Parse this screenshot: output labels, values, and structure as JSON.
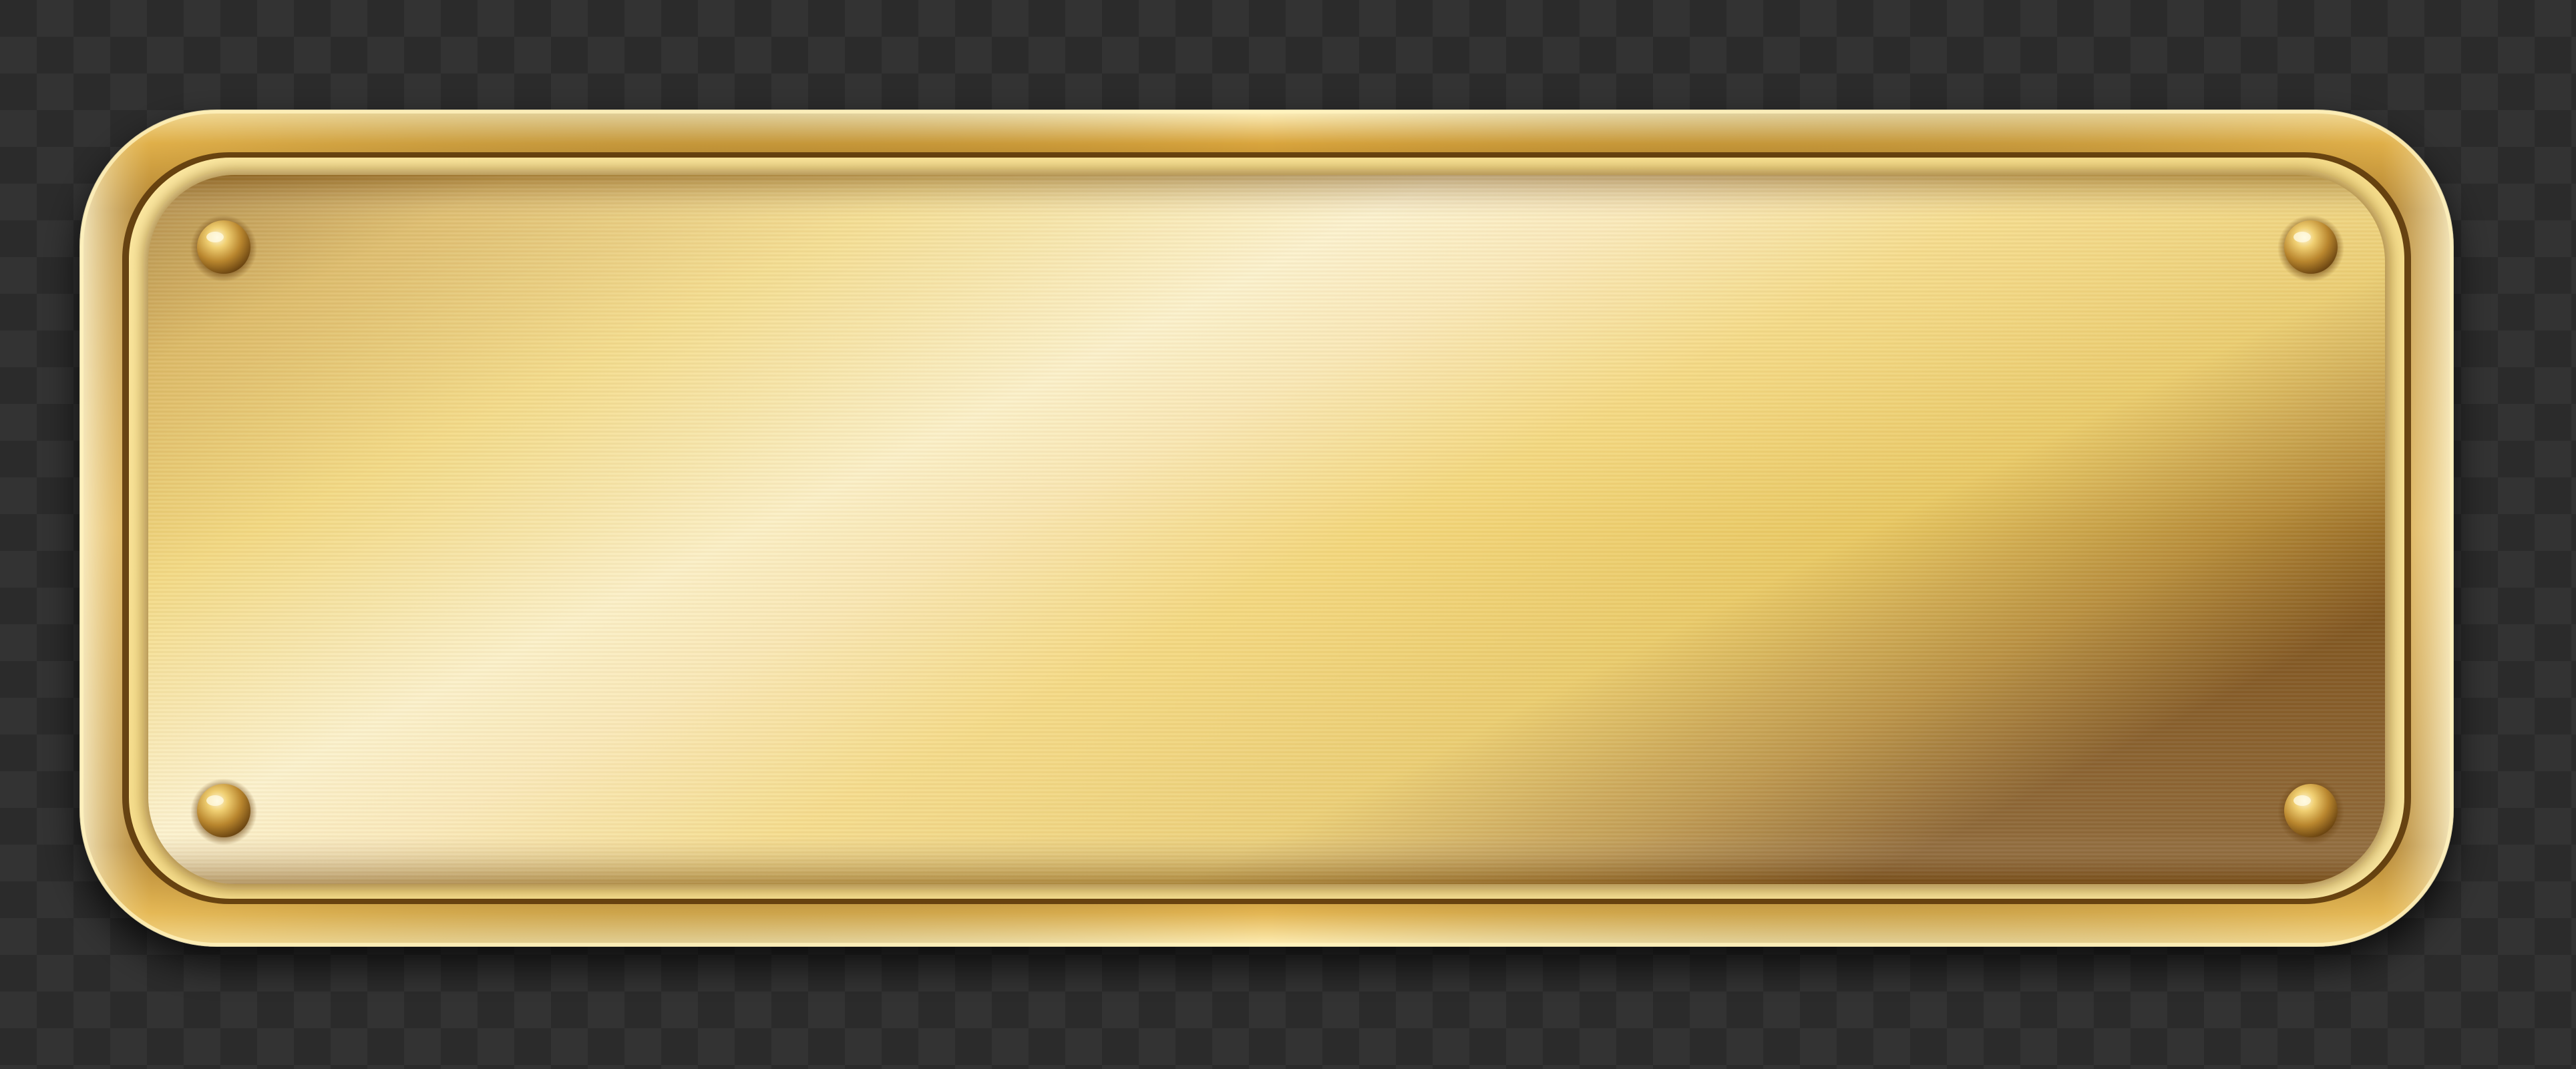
{
  "scene": {
    "subject": "blank-brass-nameplate",
    "background_pattern": "transparency-checkerboard",
    "colors": {
      "background_dark": "#2b2b2b",
      "background_light": "#333333",
      "gold_highlight": "#fbf1c8",
      "gold_mid": "#f0d77a",
      "gold_deep": "#c79a3a",
      "gold_shadow": "#7a4e16",
      "frame_dark": "#6b420f"
    },
    "screw_count": 4
  }
}
